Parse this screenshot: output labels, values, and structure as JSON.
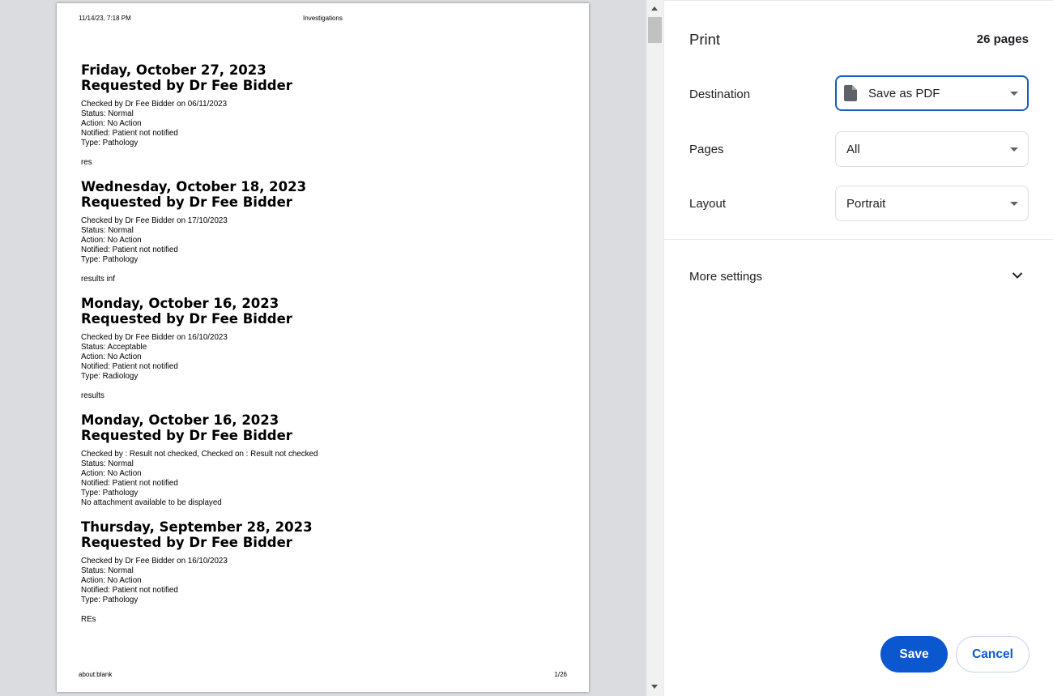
{
  "preview": {
    "header_date": "11/14/23, 7:18 PM",
    "header_title": "Investigations",
    "footer_url": "about:blank",
    "footer_page": "1/26",
    "entries": [
      {
        "date": "Friday, October 27, 2023",
        "requested": "Requested by Dr Fee Bidder",
        "checked": "Checked by Dr Fee Bidder on 06/11/2023",
        "status": "Status: Normal",
        "action": "Action: No Action",
        "notified": "Notified: Patient not notified",
        "type": "Type: Pathology",
        "note": "res"
      },
      {
        "date": "Wednesday, October 18, 2023",
        "requested": "Requested by Dr Fee Bidder",
        "checked": "Checked by Dr Fee Bidder on 17/10/2023",
        "status": "Status: Normal",
        "action": "Action: No Action",
        "notified": "Notified: Patient not notified",
        "type": "Type: Pathology",
        "note": "results inf"
      },
      {
        "date": "Monday, October 16, 2023",
        "requested": "Requested by Dr Fee Bidder",
        "checked": "Checked by Dr Fee Bidder on 16/10/2023",
        "status": "Status: Acceptable",
        "action": "Action: No Action",
        "notified": "Notified: Patient not notified",
        "type": "Type: Radiology",
        "note": "results"
      },
      {
        "date": "Monday, October 16, 2023",
        "requested": "Requested by Dr Fee Bidder",
        "checked": "Checked by : Result not checked, Checked on : Result not checked",
        "status": "Status: Normal",
        "action": "Action: No Action",
        "notified": "Notified: Patient not notified",
        "type": "Type: Pathology",
        "note": "No attachment available to be displayed"
      },
      {
        "date": "Thursday, September 28, 2023",
        "requested": "Requested by Dr Fee Bidder",
        "checked": "Checked by Dr Fee Bidder on 16/10/2023",
        "status": "Status: Normal",
        "action": "Action: No Action",
        "notified": "Notified: Patient not notified",
        "type": "Type: Pathology",
        "note": "REs"
      }
    ]
  },
  "sidebar": {
    "title": "Print",
    "page_count": "26 pages",
    "destination": {
      "label": "Destination",
      "value": "Save as PDF",
      "icon": "file-icon"
    },
    "pages": {
      "label": "Pages",
      "value": "All"
    },
    "layout": {
      "label": "Layout",
      "value": "Portrait"
    },
    "more_settings": {
      "label": "More settings",
      "icon": "chevron-down-icon"
    },
    "save_label": "Save",
    "cancel_label": "Cancel"
  },
  "colors": {
    "accent": "#0b57d0",
    "focus_border": "#1a5bbf",
    "preview_background": "#dadce0"
  }
}
